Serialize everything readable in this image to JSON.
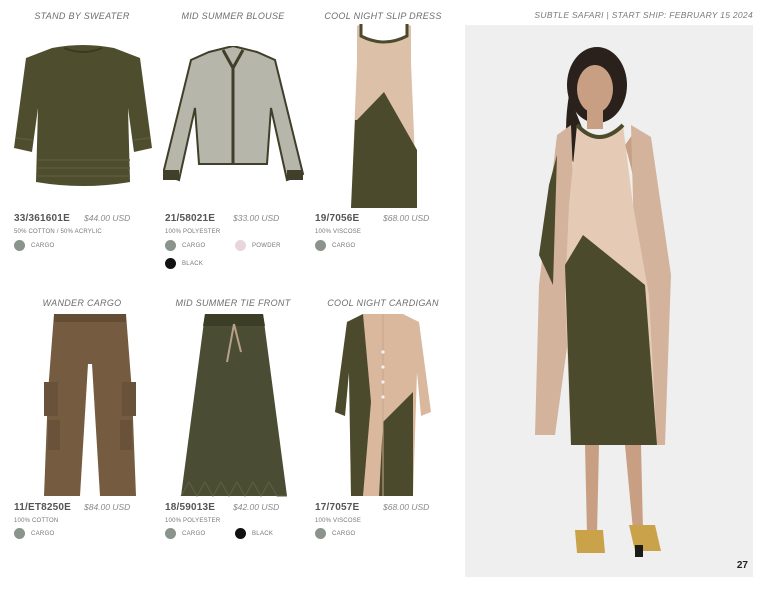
{
  "header": {
    "collection": "SUBTLE SAFARI",
    "separator": "|",
    "ship": "START SHIP: FEBRUARY 15 2024"
  },
  "colors": {
    "cargo_swatch": "#8a938c",
    "powder_swatch": "#e8d6dc",
    "black_swatch": "#111111",
    "olive": "#4b4a2c",
    "sand": "#d9b8a0"
  },
  "products": [
    {
      "title": "STAND BY SWEATER",
      "sku": "33/361601E",
      "price": "$44.00 USD",
      "fabric": "50% COTTON / 50% ACRYLIC",
      "swatches": [
        {
          "label": "CARGO"
        }
      ]
    },
    {
      "title": "MID SUMMER BLOUSE",
      "sku": "21/58021E",
      "price": "$33.00 USD",
      "fabric": "100% POLYESTER",
      "swatches": [
        {
          "label": "CARGO"
        },
        {
          "label": "POWDER"
        },
        {
          "label": "BLACK"
        }
      ]
    },
    {
      "title": "COOL NIGHT SLIP DRESS",
      "sku": "19/7056E",
      "price": "$68.00 USD",
      "fabric": "100% VISCOSE",
      "swatches": [
        {
          "label": "CARGO"
        }
      ]
    },
    {
      "title": "WANDER CARGO",
      "sku": "11/ET8250E",
      "price": "$84.00 USD",
      "fabric": "100% COTTON",
      "swatches": [
        {
          "label": "CARGO"
        }
      ]
    },
    {
      "title": "MID SUMMER TIE FRONT",
      "sku": "18/59013E",
      "price": "$42.00 USD",
      "fabric": "100% POLYESTER",
      "swatches": [
        {
          "label": "CARGO"
        },
        {
          "label": "BLACK"
        }
      ]
    },
    {
      "title": "COOL NIGHT CARDIGAN",
      "sku": "17/7057E",
      "price": "$68.00 USD",
      "fabric": "100% VISCOSE",
      "swatches": [
        {
          "label": "CARGO"
        }
      ]
    }
  ],
  "page_number": "27"
}
